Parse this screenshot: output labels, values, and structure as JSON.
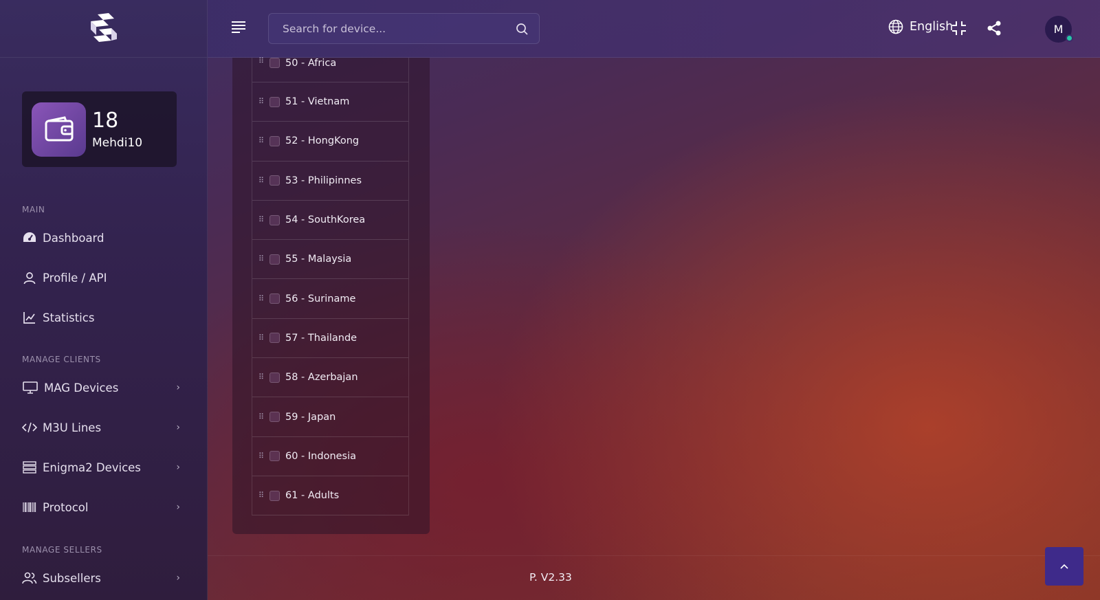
{
  "header": {
    "search_placeholder": "Search for device...",
    "language": "English",
    "avatar_initial": "M"
  },
  "wallet": {
    "count": "18",
    "username": "Mehdi10"
  },
  "sidebar": {
    "sections": {
      "main": "MAIN",
      "manage_clients": "MANAGE CLIENTS",
      "manage_sellers": "MANAGE SELLERS"
    },
    "items": [
      {
        "label": "Dashboard",
        "icon": "dashboard-icon"
      },
      {
        "label": "Profile / API",
        "icon": "user-icon"
      },
      {
        "label": "Statistics",
        "icon": "chart-line-icon"
      },
      {
        "label": "MAG Devices",
        "icon": "monitor-icon"
      },
      {
        "label": "M3U Lines",
        "icon": "code-icon"
      },
      {
        "label": "Enigma2 Devices",
        "icon": "server-icon"
      },
      {
        "label": "Protocol",
        "icon": "barcode-icon"
      },
      {
        "label": "Subsellers",
        "icon": "users-icon"
      }
    ]
  },
  "channels": [
    "50 - Africa",
    "51 - Vietnam",
    "52 - HongKong",
    "53 - Philipinnes",
    "54 - SouthKorea",
    "55 - Malaysia",
    "56 - Suriname",
    "57 - Thailande",
    "58 - Azerbajan",
    "59 - Japan",
    "60 - Indonesia",
    "61 - Adults"
  ],
  "footer": {
    "version": "P. V2.33"
  },
  "colors": {
    "accent": "#3e2a8a",
    "online": "#26c6a6"
  }
}
